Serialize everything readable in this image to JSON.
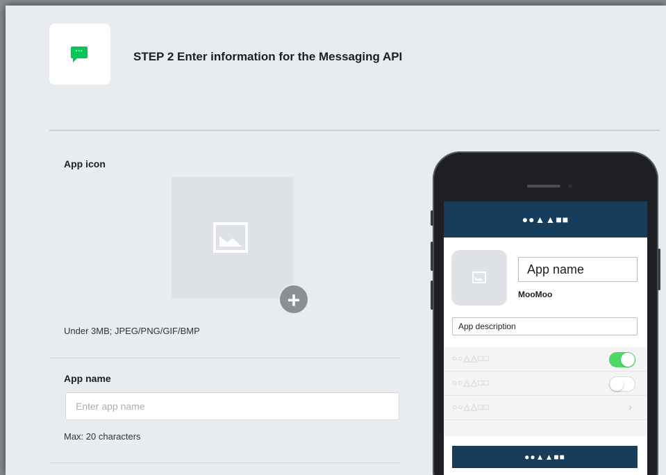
{
  "header": {
    "step_title": "STEP 2 Enter information for the Messaging API",
    "icon": "chat-bubble-icon",
    "icon_dots": "···",
    "accent_color": "#06c755"
  },
  "app_icon": {
    "label": "App icon",
    "placeholder_icon": "image-placeholder-icon",
    "add_icon": "plus-icon",
    "add_symbol": "+",
    "hint": "Under 3MB; JPEG/PNG/GIF/BMP"
  },
  "app_name": {
    "label": "App name",
    "placeholder": "Enter app name",
    "value": "",
    "hint": "Max: 20 characters"
  },
  "preview": {
    "header_text": "●●▲▲■■",
    "header_color": "#163d5c",
    "app_name": "App name",
    "account_name": "MooMoo",
    "app_description": "App description",
    "settings": [
      {
        "label": "○○△△□□",
        "control": "toggle",
        "state": "on"
      },
      {
        "label": "○○△△□□",
        "control": "toggle",
        "state": "off"
      },
      {
        "label": "○○△△□□",
        "control": "chevron-right-icon",
        "symbol": "›"
      }
    ],
    "button_text": "●●▲▲■■"
  }
}
